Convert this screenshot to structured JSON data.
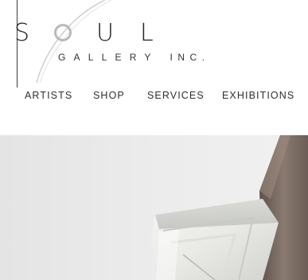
{
  "logo": {
    "word_letters": [
      "S",
      "U",
      "L"
    ],
    "subtitle_gallery": "GALLERY",
    "subtitle_inc": "INC."
  },
  "nav": {
    "items": [
      {
        "label": "ARTISTS"
      },
      {
        "label": "SHOP"
      },
      {
        "label": "SERVICES"
      },
      {
        "label": "EXHIBITIONS"
      }
    ]
  },
  "colors": {
    "text": "#2f2f2f",
    "logo_ring": "#b9b9b9",
    "hero_bg": "#e8e8e8",
    "sculpture_bronze": "#7a6b62"
  }
}
